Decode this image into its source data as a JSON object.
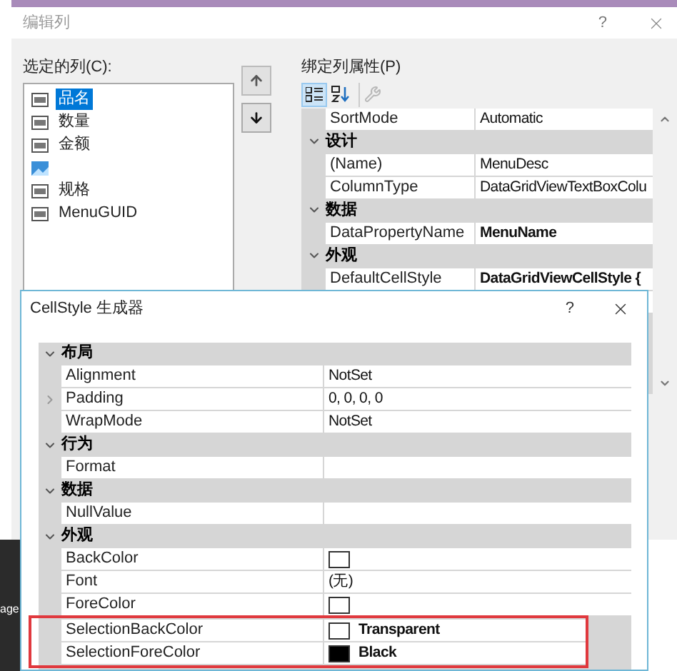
{
  "side_fragment": "age",
  "main_dialog": {
    "title": "编辑列",
    "help": "?"
  },
  "selected_columns": {
    "label": "选定的列(C):",
    "items": [
      {
        "kind": "text",
        "label": "品名",
        "selected": true
      },
      {
        "kind": "text",
        "label": "数量",
        "selected": false
      },
      {
        "kind": "text",
        "label": "金额",
        "selected": false
      },
      {
        "kind": "image",
        "selected": false
      },
      {
        "kind": "text",
        "label": "规格",
        "selected": false
      },
      {
        "kind": "text",
        "label": "MenuGUID",
        "selected": false
      }
    ]
  },
  "move_buttons": [
    {
      "kind": "up"
    },
    {
      "kind": "down"
    }
  ],
  "properties": {
    "label": "绑定列属性(P)",
    "toolbar": [
      {
        "kind": "categorized",
        "selected": true
      },
      {
        "kind": "alphabetical",
        "selected": false
      },
      {
        "kind": "property_pages",
        "disabled": true
      }
    ],
    "rows": [
      {
        "kind": "property",
        "name": "SortMode",
        "value": "Automatic"
      },
      {
        "kind": "category",
        "name": "设计",
        "expanded": true
      },
      {
        "kind": "property",
        "name": "(Name)",
        "value": "MenuDesc"
      },
      {
        "kind": "property",
        "name": "ColumnType",
        "value": "DataGridViewTextBoxColu"
      },
      {
        "kind": "category",
        "name": "数据",
        "expanded": true
      },
      {
        "kind": "property",
        "name": "DataPropertyName",
        "value": "MenuName",
        "bold": true
      },
      {
        "kind": "category",
        "name": "外观",
        "expanded": true
      },
      {
        "kind": "property",
        "name": "DefaultCellStyle",
        "value": "DataGridViewCellStyle {",
        "bold": true
      }
    ]
  },
  "cellstyle_dialog": {
    "title": "CellStyle 生成器",
    "help": "?",
    "rows": [
      {
        "kind": "category",
        "name": "布局",
        "expanded": true
      },
      {
        "kind": "property",
        "name": "Alignment",
        "value": "NotSet"
      },
      {
        "kind": "property",
        "name": "Padding",
        "value": "0, 0, 0, 0",
        "expanded": false
      },
      {
        "kind": "property",
        "name": "WrapMode",
        "value": "NotSet"
      },
      {
        "kind": "category",
        "name": "行为",
        "expanded": true
      },
      {
        "kind": "property",
        "name": "Format"
      },
      {
        "kind": "category",
        "name": "数据",
        "expanded": true
      },
      {
        "kind": "property",
        "name": "NullValue"
      },
      {
        "kind": "category",
        "name": "外观",
        "expanded": true
      },
      {
        "kind": "property",
        "name": "BackColor",
        "color": "#ffffff"
      },
      {
        "kind": "property",
        "name": "Font",
        "value": "(无)"
      },
      {
        "kind": "property",
        "name": "ForeColor",
        "color": "#ffffff"
      },
      {
        "kind": "property",
        "name": "SelectionBackColor",
        "color": "#ffffff",
        "value": "Transparent",
        "bold": true,
        "highlighted": true
      },
      {
        "kind": "property",
        "name": "SelectionForeColor",
        "color": "#000000",
        "value": "Black",
        "bold": true,
        "highlighted": true
      }
    ]
  }
}
